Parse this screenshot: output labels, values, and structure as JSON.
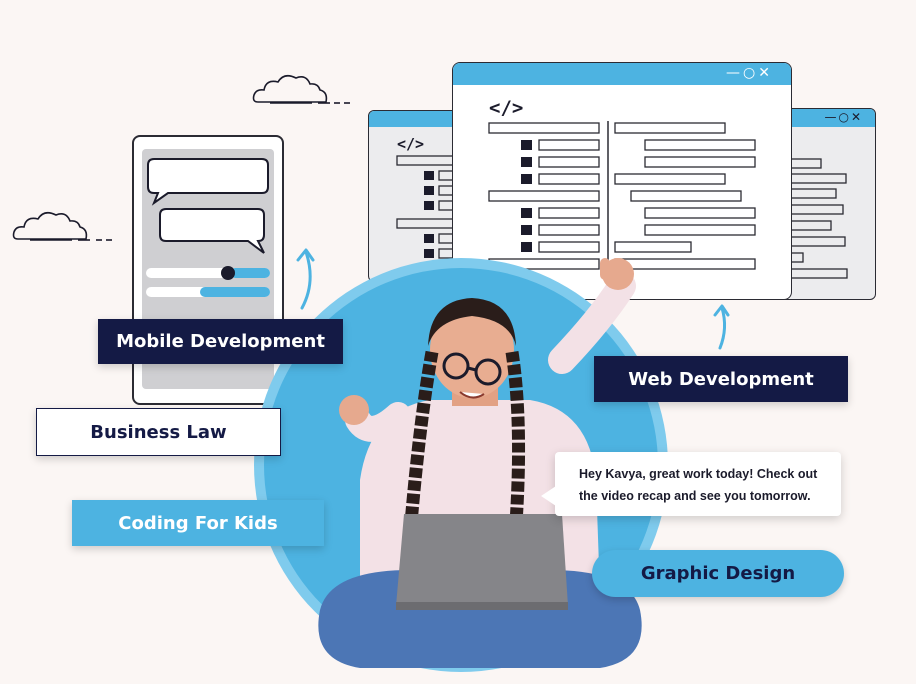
{
  "icons": {
    "code_glyph": "</>",
    "window_controls": "—○✕"
  },
  "labels": {
    "mobile_development": "Mobile Development",
    "business_law": "Business Law",
    "coding_for_kids": "Coding For Kids",
    "web_development": "Web Development",
    "graphic_design": "Graphic Design"
  },
  "chat": {
    "message_line1": "Hey Kavya, great work today! Check out",
    "message_line2": "the video recap and see you tomorrow."
  },
  "colors": {
    "accent_blue": "#4db3e1",
    "navy": "#141a45",
    "background": "#fbf6f4"
  }
}
